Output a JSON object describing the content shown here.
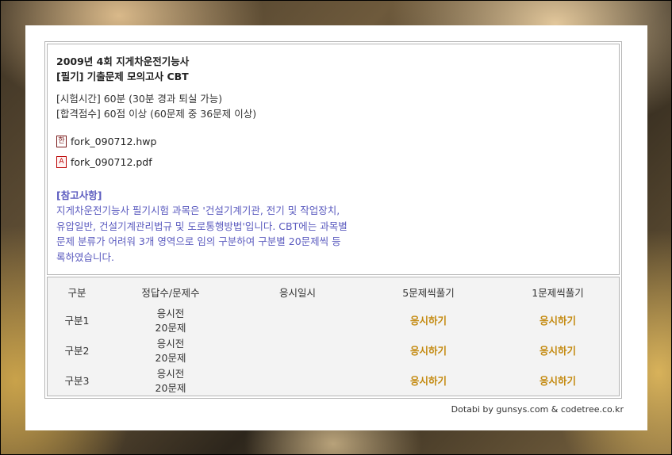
{
  "header": {
    "title_line1": "2009년 4회 지게차운전기능사",
    "title_line2": "[필기] 기출문제 모의고사 CBT"
  },
  "exam_info": {
    "time": "[시험시간] 60분 (30분 경과 퇴실 가능)",
    "pass": "[합격점수] 60점 이상 (60문제 중 36문제 이상)"
  },
  "files": [
    {
      "name": "fork_090712.hwp",
      "icon": "hwp-file-icon"
    },
    {
      "name": "fork_090712.pdf",
      "icon": "pdf-file-icon"
    }
  ],
  "note": {
    "title": "[참고사항]",
    "body": "지게차운전기능사 필기시험 과목은 '건설기계기관, 전기 및 작업장치, 유압일반, 건설기계관리법규 및 도로통행방법'입니다. CBT에는 과목별 문제 분류가 어려워 3개 영역으로 임의 구분하여 구분별 20문제씩 등록하였습니다."
  },
  "table": {
    "headers": [
      "구분",
      "정답수/문제수",
      "응시일시",
      "5문제씩풀기",
      "1문제씩풀기"
    ],
    "rows": [
      {
        "section": "구분1",
        "status": "응시전",
        "count": "20문제",
        "date": "",
        "five": "응시하기",
        "one": "응시하기"
      },
      {
        "section": "구분2",
        "status": "응시전",
        "count": "20문제",
        "date": "",
        "five": "응시하기",
        "one": "응시하기"
      },
      {
        "section": "구분3",
        "status": "응시전",
        "count": "20문제",
        "date": "",
        "five": "응시하기",
        "one": "응시하기"
      }
    ]
  },
  "footer": {
    "credit": "Dotabi by gunsys.com & codetree.co.kr"
  },
  "colors": {
    "note_text": "#5b5bbf",
    "action_text": "#c48a10",
    "border": "#b5b5b5"
  }
}
